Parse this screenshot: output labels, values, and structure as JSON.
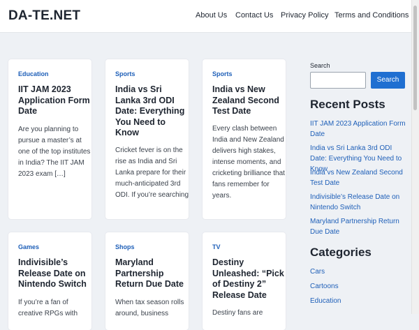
{
  "site": {
    "logo": "DA-TE.NET"
  },
  "nav": {
    "items": [
      "About Us",
      "Contact Us",
      "Privacy Policy",
      "Terms and Conditions"
    ]
  },
  "posts": [
    {
      "category": "Education",
      "title": "IIT JAM 2023 Application Form Date",
      "excerpt": "Are you planning to pursue a master’s at one of the top institutes in India? The IIT JAM 2023 exam […]"
    },
    {
      "category": "Sports",
      "title": "India vs Sri Lanka 3rd ODI Date: Everything You Need to Know",
      "excerpt": "Cricket fever is on the rise as India and Sri Lanka prepare for their much-anticipated 3rd ODI. If you’re searching"
    },
    {
      "category": "Sports",
      "title": "India vs New Zealand Second Test Date",
      "excerpt": "Every clash between India and New Zealand delivers high stakes, intense moments, and cricketing brilliance that fans remember for years."
    },
    {
      "category": "Games",
      "title": "Indivisible’s Release Date on Nintendo Switch",
      "excerpt": "If you’re a fan of creative RPGs with"
    },
    {
      "category": "Shops",
      "title": "Maryland Partnership Return Due Date",
      "excerpt": "When tax season rolls around, business"
    },
    {
      "category": "TV",
      "title": "Destiny Unleashed: “Pick of Destiny 2” Release Date",
      "excerpt": "Destiny fans are"
    }
  ],
  "sidebar": {
    "search_label": "Search",
    "search_button": "Search",
    "recent_heading": "Recent Posts",
    "recent": [
      "IIT JAM 2023 Application Form Date",
      "India vs Sri Lanka 3rd ODI Date: Everything You Need to Know",
      "India vs New Zealand Second Test Date",
      "Indivisible’s Release Date on Nintendo Switch",
      "Maryland Partnership Return Due Date"
    ],
    "categories_heading": "Categories",
    "categories": [
      "Cars",
      "Cartoons",
      "Education"
    ]
  }
}
